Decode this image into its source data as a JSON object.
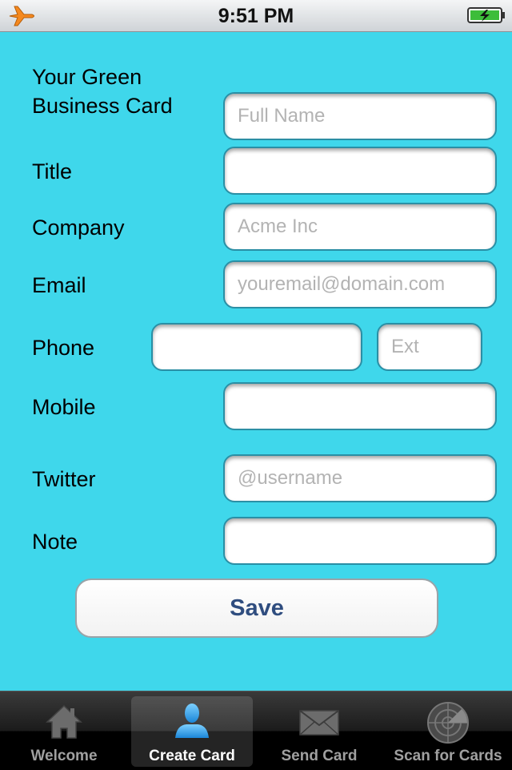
{
  "status_bar": {
    "time": "9:51 PM",
    "airplane_icon": "airplane-icon",
    "battery_icon": "battery-charging-icon"
  },
  "form": {
    "heading": "Your Green\nBusiness Card",
    "fields": {
      "full_name": {
        "placeholder": "Full Name",
        "value": ""
      },
      "title": {
        "label": "Title",
        "placeholder": "",
        "value": ""
      },
      "company": {
        "label": "Company",
        "placeholder": "Acme Inc",
        "value": ""
      },
      "email": {
        "label": "Email",
        "placeholder": "youremail@domain.com",
        "value": ""
      },
      "phone": {
        "label": "Phone",
        "placeholder": "",
        "value": ""
      },
      "ext": {
        "placeholder": "Ext",
        "value": ""
      },
      "mobile": {
        "label": "Mobile",
        "placeholder": "",
        "value": ""
      },
      "twitter": {
        "label": "Twitter",
        "placeholder": "@username",
        "value": ""
      },
      "note": {
        "label": "Note",
        "placeholder": "",
        "value": ""
      }
    },
    "save_label": "Save"
  },
  "tab_bar": {
    "tabs": [
      {
        "label": "Welcome",
        "icon": "home-icon",
        "active": false
      },
      {
        "label": "Create Card",
        "icon": "person-icon",
        "active": true
      },
      {
        "label": "Send Card",
        "icon": "envelope-icon",
        "active": false
      },
      {
        "label": "Scan for Cards",
        "icon": "radar-icon",
        "active": false
      }
    ]
  },
  "colors": {
    "background": "#3fd7eb",
    "save_text": "#2f4d7f",
    "active_tab_icon": "#3ea6ea"
  }
}
